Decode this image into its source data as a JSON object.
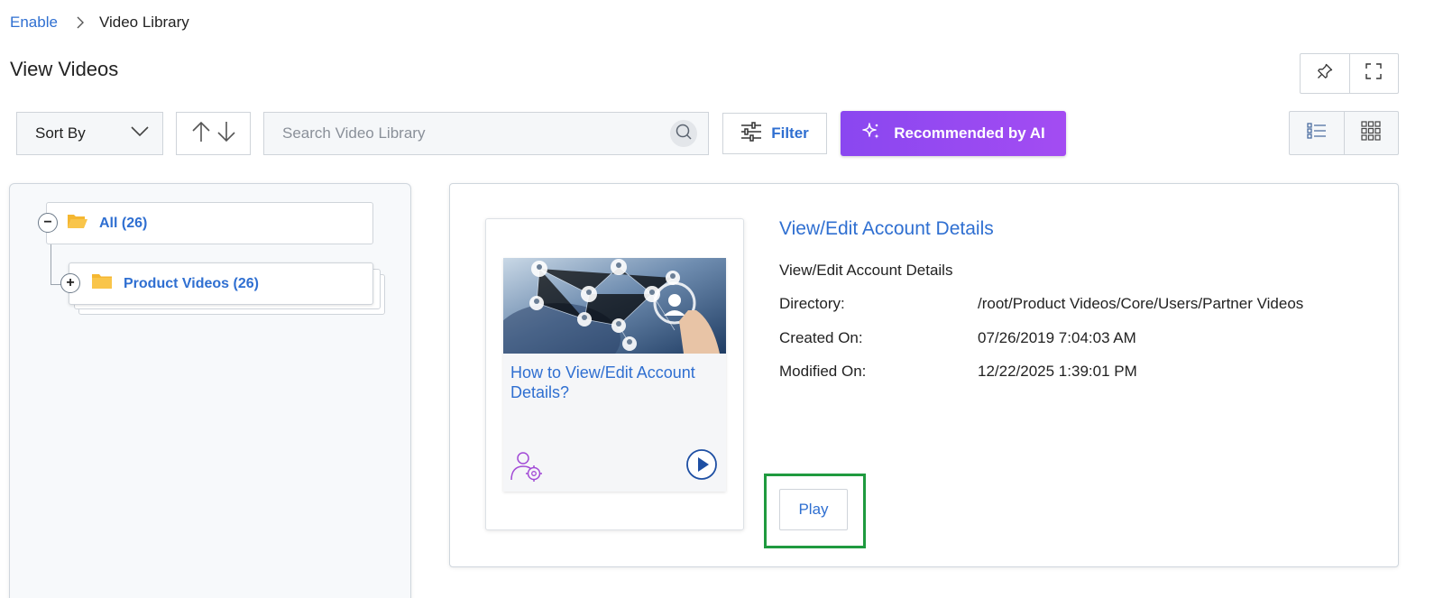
{
  "breadcrumb": {
    "root": "Enable",
    "current": "Video Library"
  },
  "page": {
    "title": "View Videos"
  },
  "toolbar": {
    "sort_label": "Sort By",
    "search_placeholder": "Search Video Library",
    "filter_label": "Filter",
    "ai_label": "Recommended by AI"
  },
  "tree": {
    "all_label": "All (26)",
    "all_toggle": "−",
    "child_label": "Product Videos (26)",
    "child_toggle": "+"
  },
  "video": {
    "card_title": "How to View/Edit Account Details?",
    "title": "View/Edit Account Details",
    "description": "View/Edit Account Details",
    "meta": {
      "directory_label": "Directory:",
      "directory_value": "/root/Product Videos/Core/Users/Partner Videos",
      "created_label": "Created On:",
      "created_value": "07/26/2019 7:04:03 AM",
      "modified_label": "Modified On:",
      "modified_value": "12/22/2025 1:39:01 PM"
    },
    "play_label": "Play"
  },
  "colors": {
    "link": "#2f6fd1",
    "ai_gradient_start": "#8a47f0",
    "ai_gradient_end": "#a34cf2",
    "highlight": "#1f9a3f",
    "folder": "#f5b731"
  }
}
